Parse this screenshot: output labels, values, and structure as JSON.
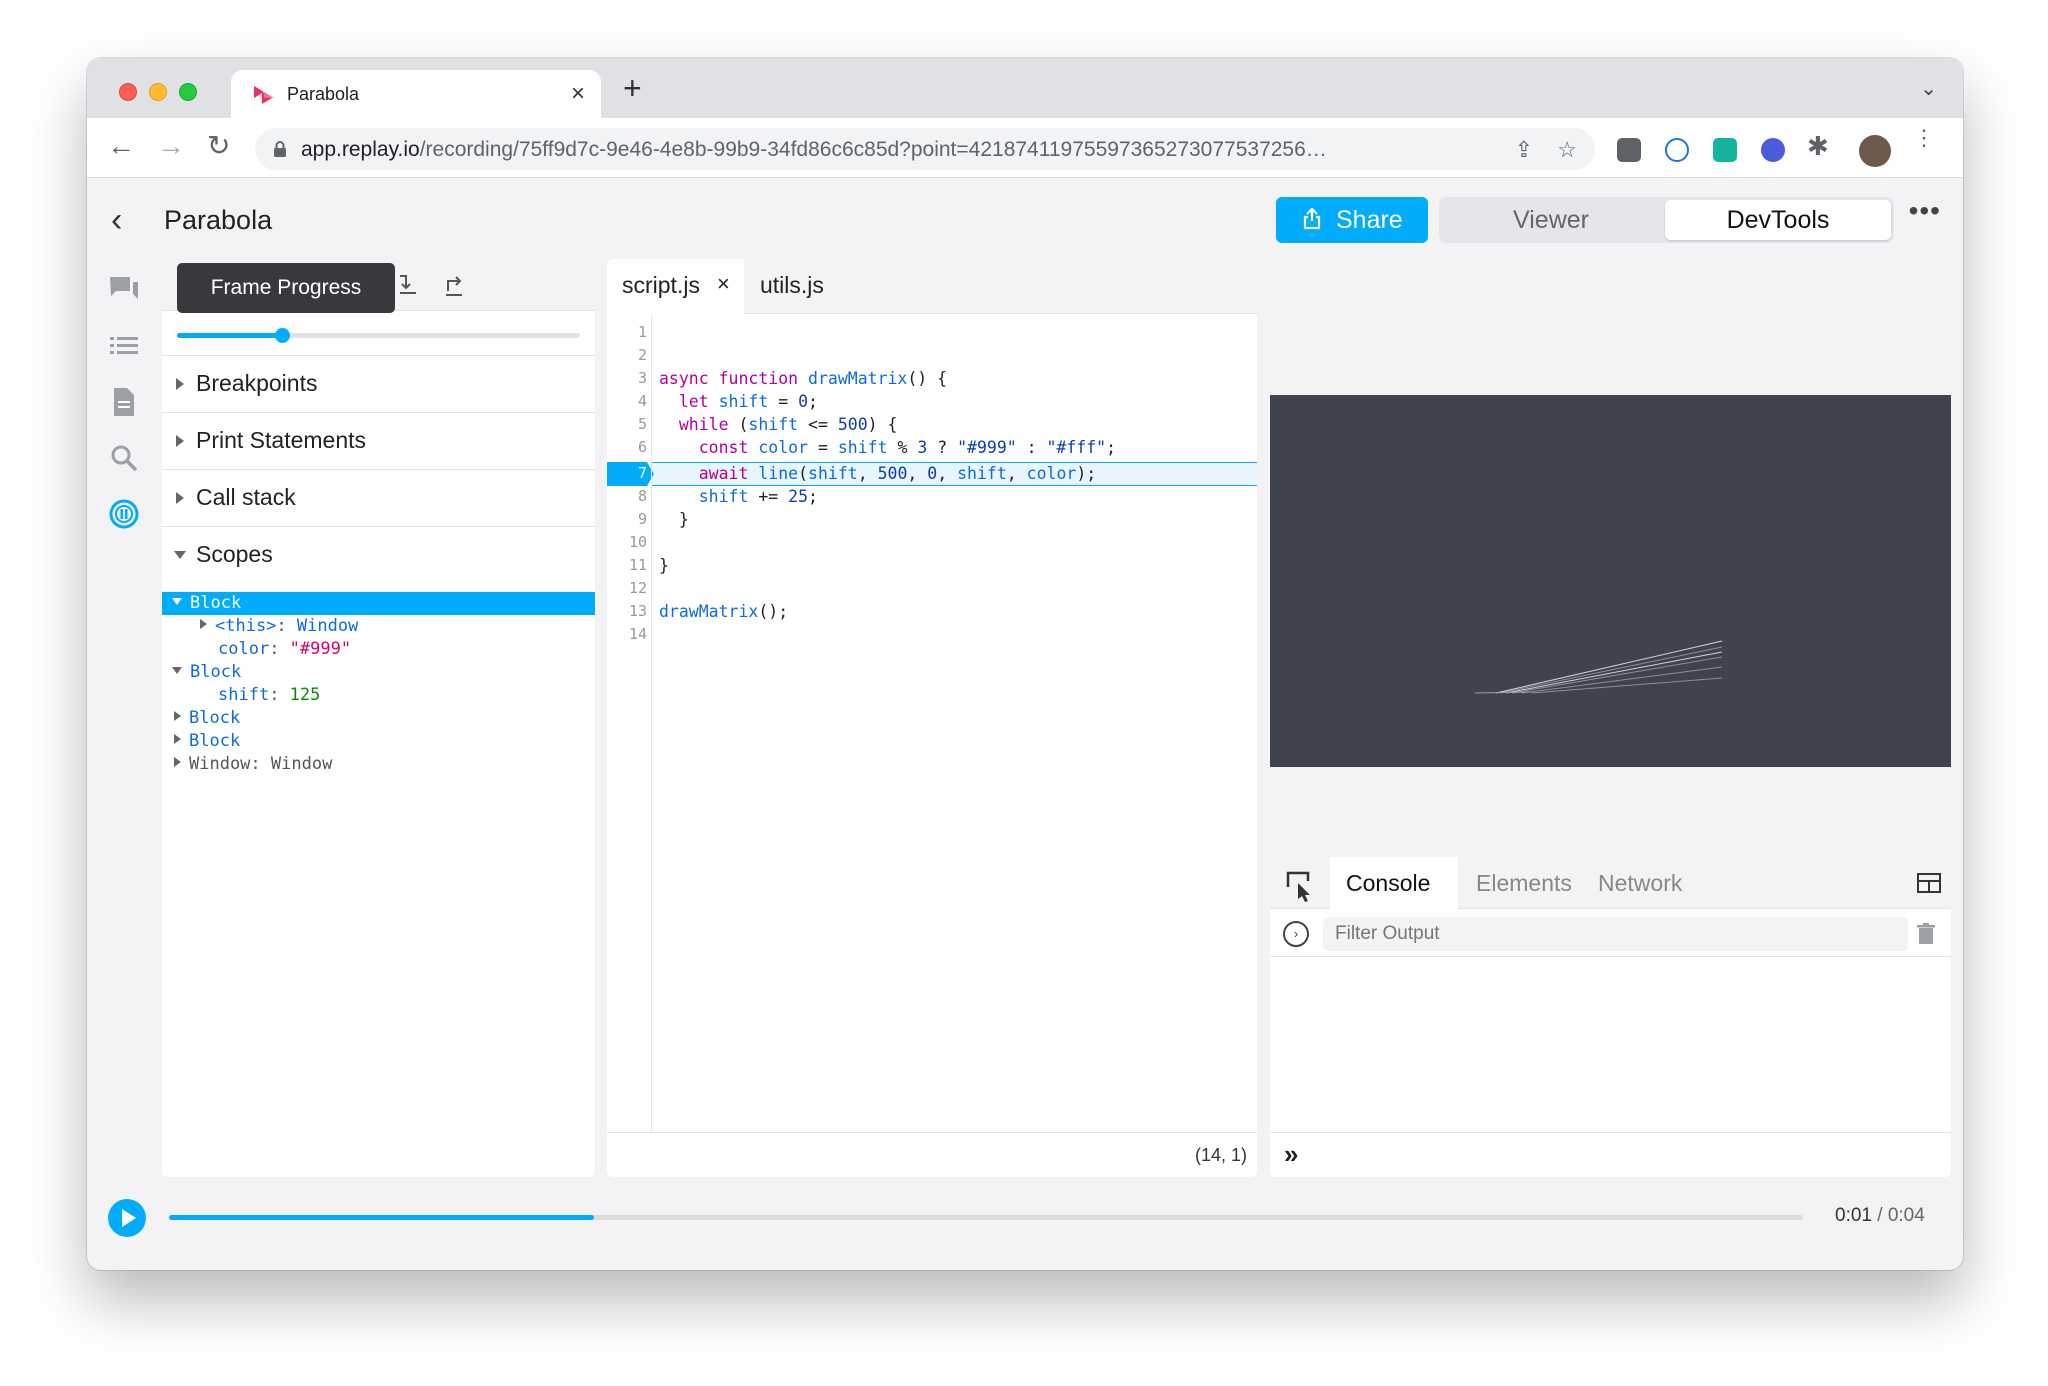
{
  "browser": {
    "tab_title": "Parabola",
    "url_host": "app.replay.io",
    "url_path": "/recording/75ff9d7c-9e46-4e8b-99b9-34fd86c6c85d?point=42187411975597365273077537256…"
  },
  "header": {
    "title": "Parabola",
    "share_label": "Share",
    "mode_viewer": "Viewer",
    "mode_devtools": "DevTools"
  },
  "left_panel": {
    "tooltip": "Frame Progress",
    "frame_progress": 0.26,
    "sections": [
      {
        "label": "Breakpoints"
      },
      {
        "label": "Print Statements"
      },
      {
        "label": "Call stack"
      },
      {
        "label": "Scopes"
      }
    ],
    "scopes": {
      "block1": "Block",
      "this_key": "<this>",
      "this_val": "Window",
      "color_key": "color",
      "color_val": "\"#999\"",
      "block2": "Block",
      "shift_key": "shift",
      "shift_val": "125",
      "block3": "Block",
      "block4": "Block",
      "window_key": "Window",
      "window_val": "Window"
    }
  },
  "editor": {
    "tabs": [
      {
        "label": "script.js"
      },
      {
        "label": "utils.js"
      }
    ],
    "line_numbers": [
      "1",
      "2",
      "3",
      "4",
      "5",
      "6",
      "7",
      "8",
      "9",
      "10",
      "11",
      "12",
      "13",
      "14"
    ],
    "highlighted_line": 7,
    "cursor_position": "(14, 1)"
  },
  "console": {
    "tabs": [
      {
        "label": "Console"
      },
      {
        "label": "Elements"
      },
      {
        "label": "Network"
      }
    ],
    "filter_placeholder": "Filter Output"
  },
  "timeline": {
    "current": "0:01",
    "separator": " / ",
    "duration": "0:04",
    "progress": 0.26
  },
  "colors": {
    "accent": "#01acfd",
    "canvas_bg": "#3e434f"
  }
}
